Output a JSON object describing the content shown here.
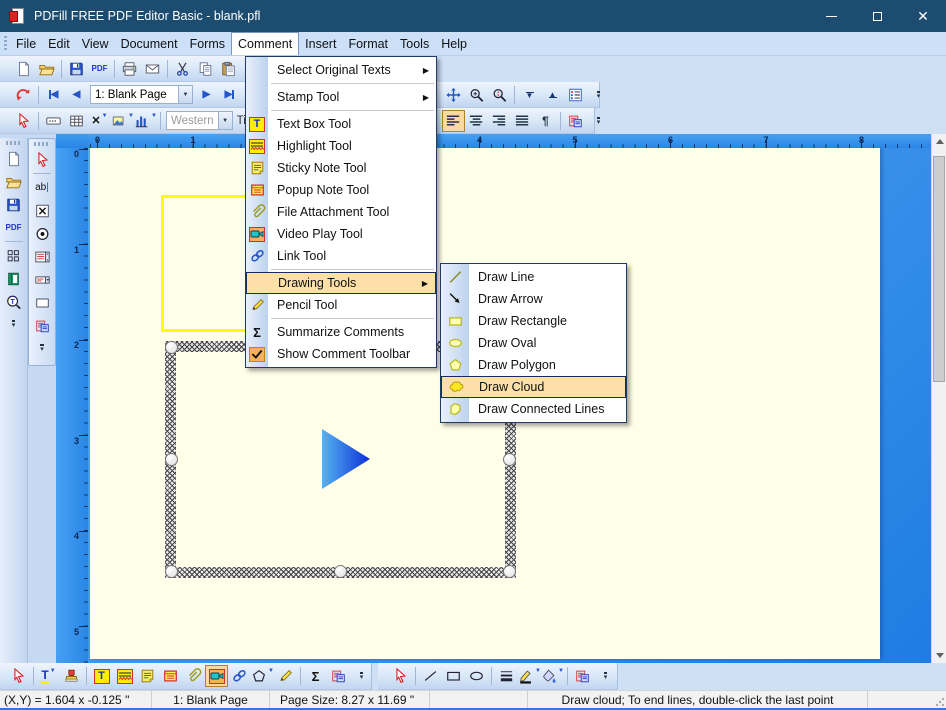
{
  "window": {
    "title": "PDFill FREE PDF Editor Basic - blank.pfl",
    "controls": [
      {
        "name": "minimize-button",
        "icon": "minimize"
      },
      {
        "name": "maximize-button",
        "icon": "maximize"
      },
      {
        "name": "close-button",
        "icon": "close"
      }
    ]
  },
  "menubar": {
    "items": [
      {
        "label": "File"
      },
      {
        "label": "Edit"
      },
      {
        "label": "View"
      },
      {
        "label": "Document"
      },
      {
        "label": "Forms"
      },
      {
        "label": "Comment",
        "open": true
      },
      {
        "label": "Insert"
      },
      {
        "label": "Format"
      },
      {
        "label": "Tools"
      },
      {
        "label": "Help"
      }
    ]
  },
  "toolbars": {
    "top1": [
      {
        "icon": "new-doc",
        "name": "new-document-button"
      },
      {
        "icon": "open-folder",
        "name": "open-button"
      },
      {
        "sep": true
      },
      {
        "icon": "save",
        "name": "save-button"
      },
      {
        "icon": "pdf-text",
        "name": "save-as-pdf-button"
      },
      {
        "sep": true
      },
      {
        "icon": "print",
        "name": "print-button"
      },
      {
        "icon": "email",
        "name": "email-button"
      },
      {
        "sep": true
      },
      {
        "icon": "cut",
        "name": "cut-button"
      },
      {
        "icon": "copy",
        "name": "copy-button"
      },
      {
        "icon": "paste",
        "name": "paste-button"
      }
    ],
    "top2": [
      {
        "icon": "refresh",
        "name": "refresh-button"
      },
      {
        "sep": true
      },
      {
        "icon": "nav-first",
        "name": "first-page-button"
      },
      {
        "icon": "nav-prev",
        "name": "previous-page-button"
      },
      {
        "combo": "1: Blank Page",
        "name": "page-selector"
      },
      {
        "icon": "nav-next",
        "name": "next-page-button"
      },
      {
        "icon": "nav-last",
        "name": "last-page-button"
      }
    ],
    "top2b": [
      {
        "icon": "pan",
        "name": "pan-tool-button"
      },
      {
        "icon": "zoom-in",
        "name": "zoom-in-button"
      },
      {
        "icon": "zoom-drag",
        "name": "zoom-dynamic-button"
      },
      {
        "sep": true
      },
      {
        "icon": "dbl-down",
        "name": "collapse-button"
      },
      {
        "icon": "dbl-up",
        "name": "expand-button"
      },
      {
        "icon": "list-settings",
        "name": "page-options-button"
      },
      {
        "icon": "ovf",
        "name": "toolbar-overflow-button"
      }
    ],
    "top3": [
      {
        "icon": "cursor",
        "name": "select-tool-button"
      },
      {
        "sep": true
      },
      {
        "icon": "field-dots",
        "name": "text-field-tool-button"
      },
      {
        "icon": "grid-table",
        "name": "table-tool-button"
      },
      {
        "icon": "x-del",
        "name": "delete-field-button"
      },
      {
        "icon": "p-image",
        "name": "image-field-button"
      },
      {
        "icon": "chart-bars",
        "name": "barcode-field-button"
      },
      {
        "sep": true
      },
      {
        "combo": "Western",
        "disabled": true,
        "name": "font-encoding-selector"
      },
      {
        "text": "Ti",
        "name": "font-name-partial"
      }
    ],
    "top3b": [
      {
        "icon": "align-left",
        "name": "align-left-button",
        "pressed": true
      },
      {
        "icon": "align-center",
        "name": "align-center-button"
      },
      {
        "icon": "align-right",
        "name": "align-right-button"
      },
      {
        "icon": "align-justify",
        "name": "align-justify-button"
      },
      {
        "icon": "pilcrow",
        "name": "paragraph-marks-button"
      },
      {
        "sep": true
      },
      {
        "icon": "paste-special",
        "name": "paste-special-button"
      },
      {
        "icon": "ovf",
        "name": "toolbar-overflow-button"
      }
    ],
    "left1": [
      {
        "icon": "new-doc",
        "name": "new-document-button"
      },
      {
        "icon": "open-folder",
        "name": "open-button"
      },
      {
        "icon": "save",
        "name": "save-button"
      },
      {
        "icon": "pdf-text",
        "name": "save-as-pdf-button"
      },
      {
        "sep": true
      },
      {
        "icon": "grid4",
        "name": "multiple-pages-button"
      },
      {
        "icon": "book",
        "name": "book-view-button"
      },
      {
        "icon": "zoom-T",
        "name": "zoom-text-button"
      },
      {
        "icon": "ovf",
        "name": "toolbar-overflow-button"
      }
    ],
    "left2": [
      {
        "icon": "cursor",
        "name": "select-tool-button"
      },
      {
        "sep": true
      },
      {
        "icon": "ab-field",
        "name": "text-field-button"
      },
      {
        "icon": "x-box",
        "name": "checkbox-field-button"
      },
      {
        "icon": "radio",
        "name": "radio-field-button"
      },
      {
        "icon": "list-box",
        "name": "listbox-field-button"
      },
      {
        "icon": "combo-box",
        "name": "combobox-field-button"
      },
      {
        "icon": "blank-rect",
        "name": "button-field-button"
      },
      {
        "icon": "paste-special",
        "name": "paste-special-button"
      },
      {
        "icon": "ovf",
        "name": "toolbar-overflow-button"
      }
    ],
    "bottom1": [
      {
        "icon": "cursor",
        "name": "select-tool-button"
      },
      {
        "sep": true
      },
      {
        "icon": "text-dd",
        "name": "select-text-tool-button"
      },
      {
        "icon": "stamp",
        "name": "stamp-tool-button"
      },
      {
        "sep": true
      },
      {
        "icon": "textbox",
        "name": "text-box-tool-button"
      },
      {
        "icon": "highlight",
        "name": "highlight-tool-button"
      },
      {
        "icon": "sticky-note",
        "name": "sticky-note-tool-button"
      },
      {
        "icon": "popup-note",
        "name": "popup-note-tool-button"
      },
      {
        "icon": "paperclip",
        "name": "file-attachment-tool-button"
      },
      {
        "icon": "video",
        "name": "video-play-tool-button",
        "pressed": true
      },
      {
        "icon": "link",
        "name": "link-tool-button"
      },
      {
        "icon": "polygon-dd",
        "name": "drawing-tools-button"
      },
      {
        "icon": "pencil",
        "name": "pencil-tool-button"
      },
      {
        "sep": true
      },
      {
        "icon": "sigma",
        "name": "summarize-comments-button"
      },
      {
        "icon": "paste-special",
        "name": "paste-special-button"
      },
      {
        "icon": "ovf",
        "name": "toolbar-overflow-button"
      }
    ],
    "bottom2": [
      {
        "icon": "cursor",
        "name": "select-tool-button"
      },
      {
        "sep": true
      },
      {
        "icon": "draw-line",
        "name": "line-style-button"
      },
      {
        "icon": "draw-rect",
        "name": "rectangle-style-button"
      },
      {
        "icon": "draw-oval",
        "name": "oval-style-button"
      },
      {
        "sep": true
      },
      {
        "icon": "line-width",
        "name": "line-width-button"
      },
      {
        "icon": "pen-dd",
        "name": "stroke-color-button"
      },
      {
        "icon": "fill-dd",
        "name": "fill-color-button"
      },
      {
        "sep": true
      },
      {
        "icon": "paste-special",
        "name": "paste-special-button"
      },
      {
        "icon": "ovf",
        "name": "toolbar-overflow-button"
      }
    ]
  },
  "comment_menu": {
    "items": [
      {
        "label": "Select Original Texts",
        "arrow": true,
        "sep_after": true
      },
      {
        "label": "Stamp Tool",
        "arrow": true,
        "sep_after": true
      },
      {
        "label": "Text Box Tool",
        "icon": "textbox"
      },
      {
        "label": "Highlight Tool",
        "icon": "highlight"
      },
      {
        "label": "Sticky Note Tool",
        "icon": "sticky-note"
      },
      {
        "label": "Popup Note Tool",
        "icon": "popup-note"
      },
      {
        "label": "File Attachment Tool",
        "icon": "paperclip"
      },
      {
        "label": "Video Play Tool",
        "icon": "video"
      },
      {
        "label": "Link Tool",
        "icon": "link",
        "sep_after": true
      },
      {
        "label": "Drawing Tools",
        "arrow": true,
        "highlighted": true
      },
      {
        "label": "Pencil Tool",
        "icon": "pencil",
        "sep_after": true
      },
      {
        "label": "Summarize Comments",
        "icon": "sigma"
      },
      {
        "label": "Show Comment Toolbar",
        "icon": "check"
      }
    ]
  },
  "drawing_submenu": {
    "items": [
      {
        "label": "Draw Line",
        "icon": "line"
      },
      {
        "label": "Draw Arrow",
        "icon": "arrow"
      },
      {
        "label": "Draw Rectangle",
        "icon": "rect"
      },
      {
        "label": "Draw Oval",
        "icon": "oval"
      },
      {
        "label": "Draw Polygon",
        "icon": "polygon"
      },
      {
        "label": "Draw Cloud",
        "icon": "cloud",
        "highlighted": true
      },
      {
        "label": "Draw Connected Lines",
        "icon": "connected"
      }
    ]
  },
  "canvas": {
    "h_ruler": [
      "0",
      "1",
      "2",
      "3",
      "4",
      "5",
      "6",
      "7",
      "8"
    ],
    "v_ruler": [
      "0",
      "1",
      "2",
      "3",
      "4",
      "5"
    ],
    "colors": {
      "page": "#fffee8",
      "surround_blue": "#2a86e6",
      "annotation_yellow": "#ffff00",
      "triangle_light": "#55b4f2",
      "triangle_dark": "#0c2fd8",
      "menu_highlight": "#fce0a8",
      "titlebar": "#1c4c70"
    }
  },
  "statusbar": {
    "xy": "(X,Y) = 1.604 x -0.125 \"",
    "page": "1: Blank Page",
    "page_size": "Page Size: 8.27 x 11.69 \"",
    "hint": "Draw cloud; To end lines, double-click the last point"
  }
}
